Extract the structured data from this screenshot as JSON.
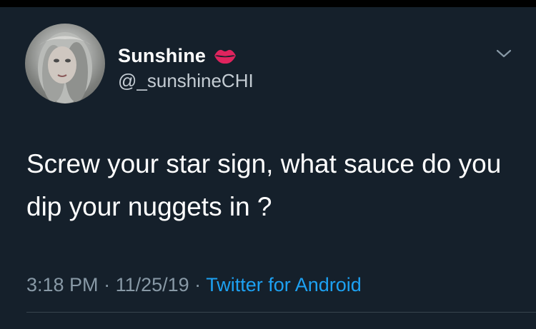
{
  "tweet": {
    "display_name": "Sunshine",
    "handle": "@_sunshineCHI",
    "text": "Screw your star sign, what sauce do you dip your nuggets in ?",
    "time": "3:18 PM",
    "separator": " · ",
    "date": "11/25/19",
    "source": "Twitter for Android",
    "name_emoji": "lips-kiss-icon",
    "menu_icon": "chevron-down-icon",
    "avatar": "profile-avatar"
  },
  "colors": {
    "background": "#15202b",
    "text": "#ffffff",
    "secondary_text": "#8899a6",
    "link": "#1da1f2",
    "lips": "#e0245e"
  }
}
